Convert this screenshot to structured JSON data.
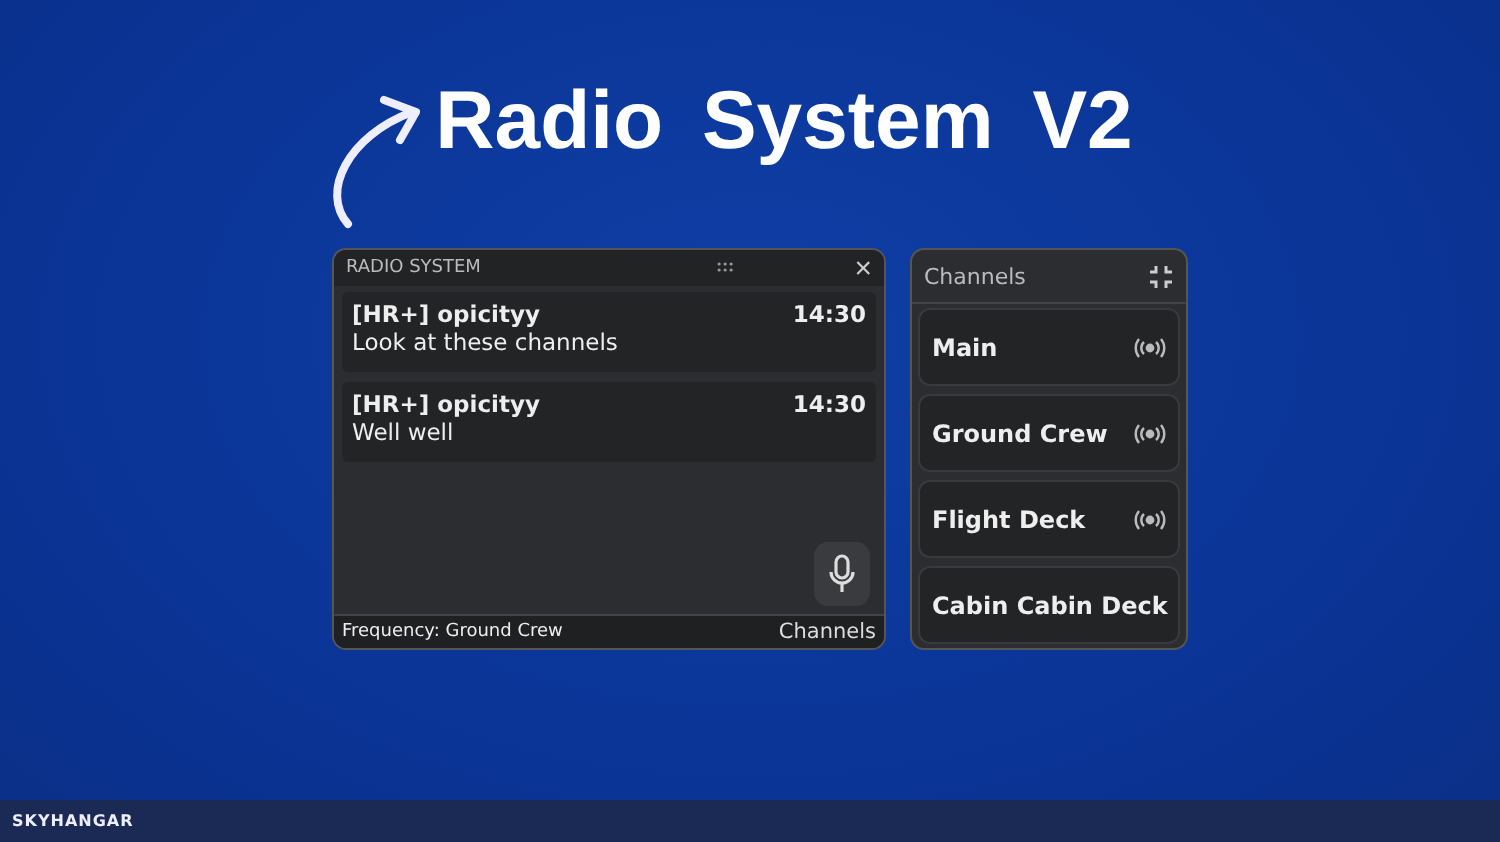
{
  "headline": "Radio System V2",
  "radio_window": {
    "title": "RADIO SYSTEM",
    "close": "×",
    "messages": [
      {
        "sender": "[HR+] opicityy",
        "time": "14:30",
        "text": "Look at these channels"
      },
      {
        "sender": "[HR+] opicityy",
        "time": "14:30",
        "text": "Well well"
      }
    ],
    "frequency": "Frequency: Ground Crew",
    "channels_link": "Channels"
  },
  "channels_panel": {
    "title": "Channels",
    "channels": [
      {
        "name": "Main"
      },
      {
        "name": "Ground Crew"
      },
      {
        "name": "Flight Deck"
      },
      {
        "name": "Cabin Cabin Deck"
      }
    ]
  },
  "footer": {
    "brand": "SKYHANGAR"
  }
}
